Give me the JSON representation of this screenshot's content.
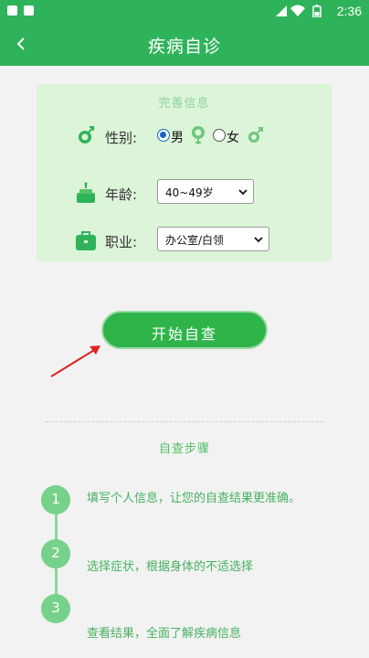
{
  "status_bar": {
    "time": "2:36"
  },
  "app_bar": {
    "title": "疾病自诊"
  },
  "info_card": {
    "title": "完善信息",
    "gender_label": "性别:",
    "gender_options": [
      "男",
      "女"
    ],
    "gender_selected": "男",
    "age_label": "年龄:",
    "age_value": "40~49岁",
    "job_label": "职业:",
    "job_value": "办公室/白领"
  },
  "start_button": {
    "label": "开始自查"
  },
  "steps": {
    "title": "自查步骤",
    "items": [
      {
        "num": "1",
        "text": "填写个人信息，让您的自查结果更准确。"
      },
      {
        "num": "2",
        "text": "选择症状，根据身体的不适选择"
      },
      {
        "num": "3",
        "text": "查看结果，全面了解疾病信息"
      }
    ]
  },
  "colors": {
    "primary": "#2fb35a",
    "card_bg": "#dcf4d8",
    "accent_text": "#46b260"
  }
}
